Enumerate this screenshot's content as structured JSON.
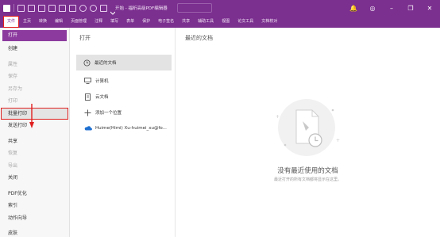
{
  "title_bar": {
    "doc_title": "开始 - 福昕高级PDF编辑器",
    "window_controls": [
      "minimize-icon",
      "restore-icon",
      "close-icon"
    ]
  },
  "menu": [
    "文件",
    "主页",
    "转换",
    "编辑",
    "页面管理",
    "注释",
    "填写",
    "表单",
    "保护",
    "电子签名",
    "共享",
    "辅助工具",
    "视图",
    "论文工具",
    "文档校对"
  ],
  "left_nav": {
    "items": [
      {
        "label": "打开",
        "state": "selected"
      },
      {
        "label": "创建",
        "state": "normal"
      },
      {
        "label": "属性",
        "state": "disabled"
      },
      {
        "label": "保存",
        "state": "disabled"
      },
      {
        "label": "另存为",
        "state": "disabled"
      },
      {
        "label": "打印",
        "state": "disabled"
      },
      {
        "label": "批量打印",
        "state": "highlighted"
      },
      {
        "label": "发送打印",
        "state": "normal"
      },
      {
        "label": "共享",
        "state": "normal"
      },
      {
        "label": "恢复",
        "state": "disabled"
      },
      {
        "label": "导出",
        "state": "disabled"
      },
      {
        "label": "关闭",
        "state": "normal"
      },
      {
        "label": "PDF优化",
        "state": "normal"
      },
      {
        "label": "索引",
        "state": "normal"
      },
      {
        "label": "动作向导",
        "state": "normal"
      },
      {
        "label": "皮肤",
        "state": "normal"
      }
    ]
  },
  "open_panel": {
    "heading": "打开",
    "items": [
      {
        "label": "最近的文档",
        "icon": "clock-icon"
      },
      {
        "label": "计算机",
        "icon": "monitor-icon"
      },
      {
        "label": "云文档",
        "icon": "cloud-doc-icon"
      },
      {
        "label": "添加一个位置",
        "icon": "plus-icon"
      },
      {
        "label": "Huime(Himi) Xu-huimei_xu@fo...",
        "icon": "onedrive-icon"
      }
    ]
  },
  "recent_panel": {
    "heading": "最近的文档",
    "empty_title": "没有最近使用的文档",
    "empty_subtitle": "最近打开的所有文档都将显示在这里。"
  },
  "colors": {
    "brand": "#7b2f8f",
    "selected_nav": "#8c3a9e",
    "highlight_box": "#e02020"
  }
}
